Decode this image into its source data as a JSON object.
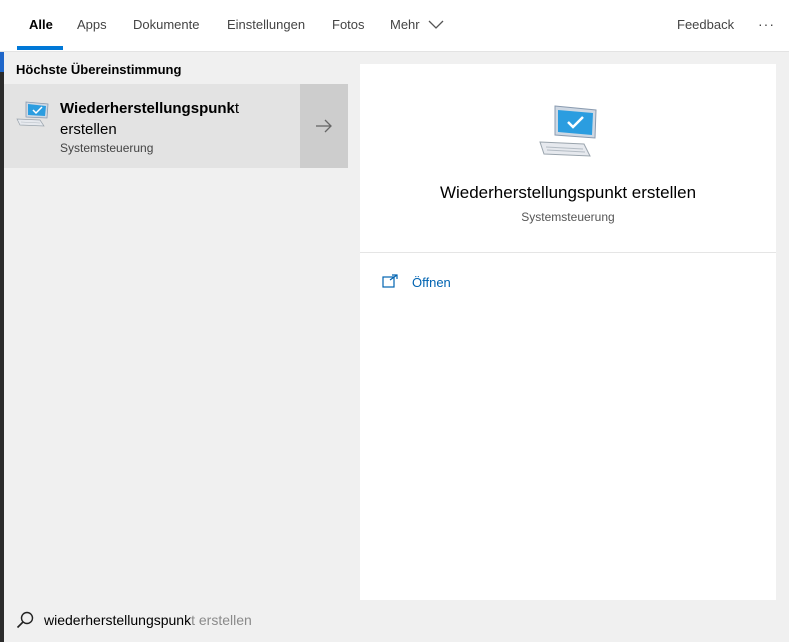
{
  "nav": {
    "tabs": [
      {
        "label": "Alle",
        "active": true
      },
      {
        "label": "Apps"
      },
      {
        "label": "Dokumente"
      },
      {
        "label": "Einstellungen"
      },
      {
        "label": "Fotos"
      },
      {
        "label": "Mehr"
      }
    ],
    "feedback": "Feedback",
    "more_dots": "···",
    "accent_color": "#0078d7"
  },
  "results": {
    "section_heading": "Höchste Übereinstimmung",
    "best_match": {
      "title_bold": "Wiederherstellungspunk",
      "title_rest_1": "t",
      "title_rest_2": "erstellen",
      "subtitle": "Systemsteuerung",
      "icon": "monitor-checkmark-icon"
    }
  },
  "preview": {
    "title": "Wiederherstellungspunkt erstellen",
    "subtitle": "Systemsteuerung",
    "icon": "monitor-checkmark-icon",
    "actions": [
      {
        "label": "Öffnen",
        "icon": "open-window-icon",
        "color": "#0063b1"
      }
    ]
  },
  "search": {
    "typed": "wiederherstellungspunk",
    "suggestion": "t erstellen"
  }
}
